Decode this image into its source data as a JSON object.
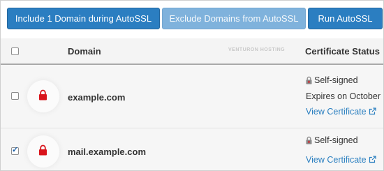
{
  "toolbar": {
    "include_label": "Include 1 Domain during AutoSSL",
    "exclude_label": "Exclude Domains from AutoSSL",
    "run_label": "Run AutoSSL"
  },
  "table": {
    "headers": {
      "domain": "Domain",
      "certificate_status": "Certificate Status"
    },
    "watermark": "VENTURON HOSTING",
    "rows": [
      {
        "domain": "example.com",
        "checked": false,
        "status": "Self-signed",
        "expires": "Expires on October",
        "link": "View Certificate"
      },
      {
        "domain": "mail.example.com",
        "checked": true,
        "status": "Self-signed",
        "link": "View Certificate"
      }
    ]
  },
  "colors": {
    "primary_button": "#2b7ec1",
    "disabled_button": "#7fb2dc",
    "link": "#2a7fc0",
    "lock_red": "#d9141b"
  },
  "icons": {
    "row_lock": "lock-icon",
    "status_lock": "mini-lock-icon",
    "external_link": "external-link-icon"
  }
}
